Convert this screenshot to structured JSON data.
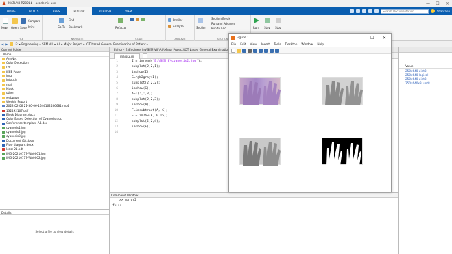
{
  "app": {
    "title": "MATLAB R2021b - academic use",
    "minimize": "—",
    "maximize": "☐",
    "close": "✕"
  },
  "ribbon_tabs": [
    "HOME",
    "PLOTS",
    "APPS",
    "EDITOR",
    "PUBLISH",
    "VIEW"
  ],
  "search": {
    "placeholder": "Search Documentation",
    "user": "Shantanu"
  },
  "ribbon": {
    "file": {
      "label": "FILE",
      "new": "New",
      "open": "Open",
      "save": "Save",
      "compare": "Compare",
      "print": "Print"
    },
    "navigate": {
      "label": "NAVIGATE",
      "goto": "Go To",
      "find": "Find",
      "bookmark": "Bookmark"
    },
    "code": {
      "label": "CODE",
      "refactor": "Refactor"
    },
    "analyze": {
      "label": "ANALYZE",
      "profiler": "Profiler",
      "analyze": "Analyze"
    },
    "section": {
      "label": "SECTION",
      "section": "Section",
      "section_break": "Section Break",
      "run_advance": "Run and Advance",
      "run_to_end": "Run to End"
    },
    "run": {
      "label": "RUN",
      "run": "Run",
      "step": "Step",
      "stop": "Stop"
    }
  },
  "path": {
    "text": "E: ▸ Engineering ▸ SEM VIII ▸ AII ▸ Major Project ▸ IOT based General Examination of Patient ▸"
  },
  "current_folder": {
    "title": "Current Folder",
    "header": "Name",
    "items": [
      {
        "name": "AnnNet",
        "type": "folder"
      },
      {
        "name": "Color Detection",
        "type": "folder"
      },
      {
        "name": "I2C",
        "type": "folder"
      },
      {
        "name": "IEEE Paper",
        "type": "folder"
      },
      {
        "name": "img",
        "type": "folder"
      },
      {
        "name": "Intouch",
        "type": "folder"
      },
      {
        "name": "mail",
        "type": "folder"
      },
      {
        "name": "Mask",
        "type": "folder"
      },
      {
        "name": "other",
        "type": "folder"
      },
      {
        "name": "webpage",
        "type": "folder"
      },
      {
        "name": "Weekly Report",
        "type": "folder"
      },
      {
        "name": "2022-02-06 21-30-06-1644162556681.mp4",
        "type": "video"
      },
      {
        "name": "132492107.pdf",
        "type": "pdf"
      },
      {
        "name": "Block Diagram.docx",
        "type": "doc"
      },
      {
        "name": "Color Based Detection of Cyanosis.doc",
        "type": "doc"
      },
      {
        "name": "Conference-template-A4.doc",
        "type": "doc"
      },
      {
        "name": "cyanosis1.jpg",
        "type": "img"
      },
      {
        "name": "cyanosis2.jpg",
        "type": "img"
      },
      {
        "name": "cyanosis3.jpg",
        "type": "img"
      },
      {
        "name": "Document (1).docx",
        "type": "doc"
      },
      {
        "name": "Flow diagram.docx",
        "type": "doc"
      },
      {
        "name": "Icast 21.pdf",
        "type": "pdf"
      },
      {
        "name": "IMG-20210717-WA0001.jpg",
        "type": "img"
      },
      {
        "name": "IMG-20210717-WA0002.jpg",
        "type": "img"
      }
    ]
  },
  "details": {
    "title": "Details",
    "message": "Select a file to view details"
  },
  "editor": {
    "title": "Editor - E:\\Engineering\\SEM VIII\\AII\\Major Project\\IOT based General Examination of Patient\\major2.m",
    "tab": "major2.m",
    "lines": [
      {
        "n": "1",
        "pre": "I = imread(",
        "str": "'E:\\SEM 8\\cyanosis2.jpg'",
        "post": ");"
      },
      {
        "n": "2",
        "pre": "subplot(2,2,1);",
        "str": "",
        "post": ""
      },
      {
        "n": "3",
        "pre": "imshow(I);",
        "str": "",
        "post": ""
      },
      {
        "n": "4",
        "pre": "G=rgb2gray(I);",
        "str": "",
        "post": ""
      },
      {
        "n": "5",
        "pre": "subplot(2,2,2);",
        "str": "",
        "post": ""
      },
      {
        "n": "6",
        "pre": "imshow(G);",
        "str": "",
        "post": ""
      },
      {
        "n": "7",
        "pre": "A=I(:,:,3);",
        "str": "",
        "post": ""
      },
      {
        "n": "8",
        "pre": "subplot(2,2,3);",
        "str": "",
        "post": ""
      },
      {
        "n": "9",
        "pre": "imshow(A);",
        "str": "",
        "post": ""
      },
      {
        "n": "10",
        "pre": "F=imsubtract(A, G);",
        "str": "",
        "post": ""
      },
      {
        "n": "11",
        "pre": "F = im2bw(F, 0.15);",
        "str": "",
        "post": ""
      },
      {
        "n": "12",
        "pre": "subplot(2,2,4);",
        "str": "",
        "post": ""
      },
      {
        "n": "13",
        "pre": "imshow(F);",
        "str": "",
        "post": ""
      },
      {
        "n": "14",
        "pre": "",
        "str": "",
        "post": ""
      }
    ]
  },
  "command_window": {
    "title": "Command Window",
    "history": ">> major2",
    "prompt": "fx >>"
  },
  "workspace": {
    "header": "Value",
    "values": [
      "250x640 uint8",
      "250x640 logical",
      "250x640 uint8",
      "250x640x3 uint8"
    ]
  },
  "figure": {
    "title": "Figure 1",
    "menu": [
      "File",
      "Edit",
      "View",
      "Insert",
      "Tools",
      "Desktop",
      "Window",
      "Help"
    ]
  }
}
